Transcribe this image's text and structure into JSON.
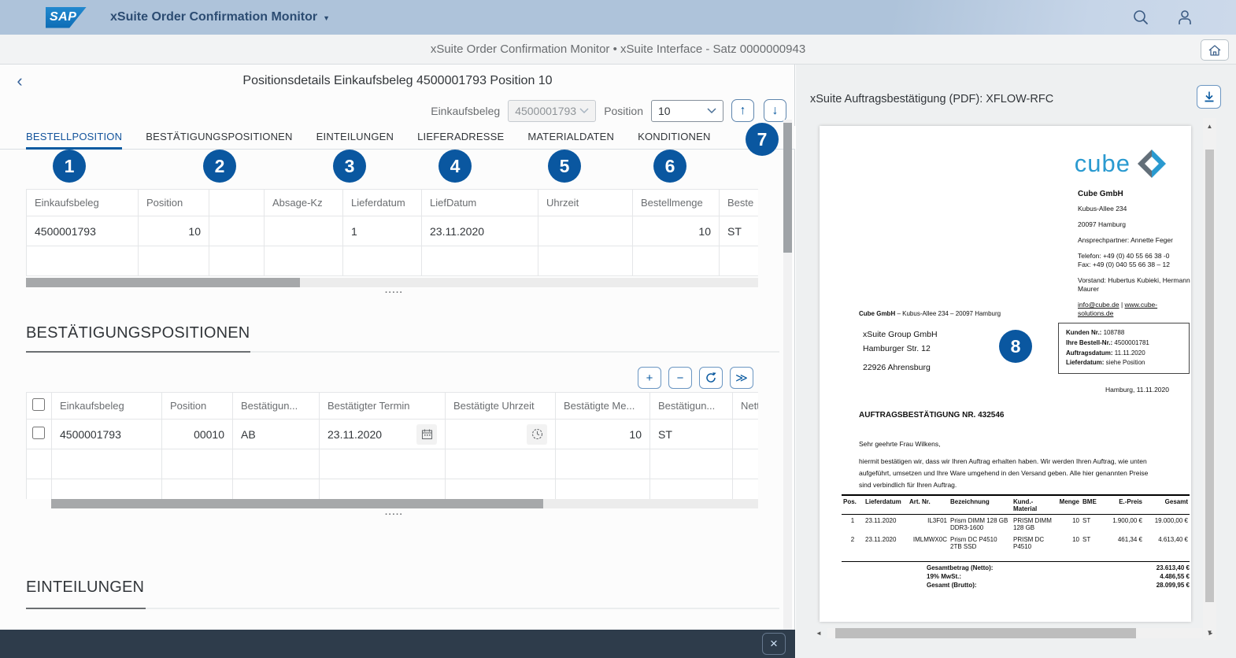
{
  "icons": {
    "caret_down": "▼",
    "back": "‹",
    "up_arrow": "↑",
    "down_arrow": "↓",
    "plus": "+",
    "minus": "−",
    "forward": "≫",
    "close": "×",
    "grip_dots": "·····",
    "tri_up": "▲",
    "tri_down": "▼",
    "tri_left": "◄",
    "tri_right": "►"
  },
  "colors": {
    "accent_blue": "#0a6ed1",
    "badge_blue": "#0a57a0",
    "shell_bg": "#aec3da",
    "footer_bg": "#2e3c4b",
    "logo_blue": "#2a9ad0"
  },
  "shell": {
    "logo_text": "SAP",
    "app_title": "xSuite Order Confirmation Monitor",
    "subtitle": "xSuite Order Confirmation Monitor • xSuite Interface - Satz 0000000943"
  },
  "detail": {
    "title": "Positionsdetails Einkaufsbeleg 4500001793 Position 10",
    "filters": {
      "doc_label": "Einkaufsbeleg",
      "doc_value": "4500001793",
      "pos_label": "Position",
      "pos_value": "10"
    },
    "tabs": [
      {
        "label": "BESTELLPOSITION",
        "badge": "1"
      },
      {
        "label": "BESTÄTIGUNGSPOSITIONEN",
        "badge": "2"
      },
      {
        "label": "EINTEILUNGEN",
        "badge": "3"
      },
      {
        "label": "LIEFERADRESSE",
        "badge": "4"
      },
      {
        "label": "MATERIALDATEN",
        "badge": "5"
      },
      {
        "label": "KONDITIONEN",
        "badge": "6"
      }
    ],
    "overflow_badge": "7",
    "table1": {
      "cols": [
        "Einkaufsbeleg",
        "Position",
        "",
        "Absage-Kz",
        "Lieferdatum",
        "LiefDatum",
        "Uhrzeit",
        "Bestellmenge",
        "Beste"
      ],
      "row": [
        "4500001793",
        "10",
        "",
        "",
        "1",
        "23.11.2020",
        "",
        "10",
        "ST"
      ]
    },
    "section_bestaetigung": "BESTÄTIGUNGSPOSITIONEN",
    "table2": {
      "cols": [
        "Einkaufsbeleg",
        "Position",
        "Bestätigun...",
        "Bestätigter Termin",
        "Bestätigte Uhrzeit",
        "Bestätigte Me...",
        "Bestätigun...",
        "Nett"
      ],
      "row": [
        "4500001793",
        "00010",
        "AB",
        "23.11.2020",
        "",
        "10",
        "ST",
        ""
      ]
    },
    "section_einteilungen": "EINTEILUNGEN"
  },
  "pdf": {
    "panel_title": "xSuite Auftragsbestätigung (PDF): XFLOW-RFC",
    "page_badge": "8",
    "logo_text": "cube",
    "company": {
      "name": "Cube GmbH",
      "street": "Kubus-Allee 234",
      "city": "20097 Hamburg",
      "contact": "Ansprechpartner: Annette Feger",
      "phone": "Telefon: +49 (0) 40 55 66 38 -0",
      "fax": "Fax: +49 (0) 040 55 66 38 – 12",
      "board": "Vorstand: Hubertus Kubieki, Hermann Maurer",
      "email": "info@cube.de",
      "sep": " | ",
      "web": "www.cube-solutions.de"
    },
    "sender_bold": "Cube GmbH",
    "sender_rest": " – Kubus-Allee 234 – 20097 Hamburg",
    "recipient": [
      "xSuite Group GmbH",
      "Hamburger Str. 12",
      "22926 Ahrensburg"
    ],
    "info_box": [
      {
        "label": "Kunden Nr.:",
        "value": " 108788"
      },
      {
        "label": "Ihre Bestell-Nr.:",
        "value": " 4500001781"
      },
      {
        "label": "Auftragsdatum:",
        "value": " 11.11.2020"
      },
      {
        "label": "Lieferdatum:",
        "value": " siehe Position"
      }
    ],
    "place_date": "Hamburg, 11.11.2020",
    "subject": "AUFTRAGSBESTÄTIGUNG NR. 432546",
    "salutation": "Sehr geehrte Frau Wilkens,",
    "body": "hiermit bestätigen wir, dass wir Ihren Auftrag erhalten haben. Wir werden Ihren Auftrag, wie unten aufgeführt, umsetzen und Ihre Ware umgehend in den Versand geben. Alle hier genannten Preise sind verbindlich für Ihren Auftrag.",
    "items": {
      "cols": [
        "Pos.",
        "Lieferdatum",
        "Art. Nr.",
        "Bezeichnung",
        "Kund.-Material",
        "Menge",
        "BME",
        "E.-Preis",
        "Gesamt"
      ],
      "rows": [
        [
          "1",
          "23.11.2020",
          "IL3F01",
          "Prism DIMM 128 GB DDR3-1600",
          "PRISM DIMM 128 GB",
          "10",
          "ST",
          "1.900,00 €",
          "19.000,00 €"
        ],
        [
          "2",
          "23.11.2020",
          "IMLMWX0C",
          "Prism DC P4510 2TB SSD",
          "PRISM DC P4510",
          "10",
          "ST",
          "461,34 €",
          "4.613,40 €"
        ]
      ]
    },
    "totals": [
      {
        "label": "Gesamtbetrag (Netto):",
        "value": "23.613,40 €"
      },
      {
        "label": "19% MwSt.:",
        "value": "4.486,55 €"
      },
      {
        "label": "Gesamt (Brutto):",
        "value": "28.099,95 €"
      }
    ]
  }
}
